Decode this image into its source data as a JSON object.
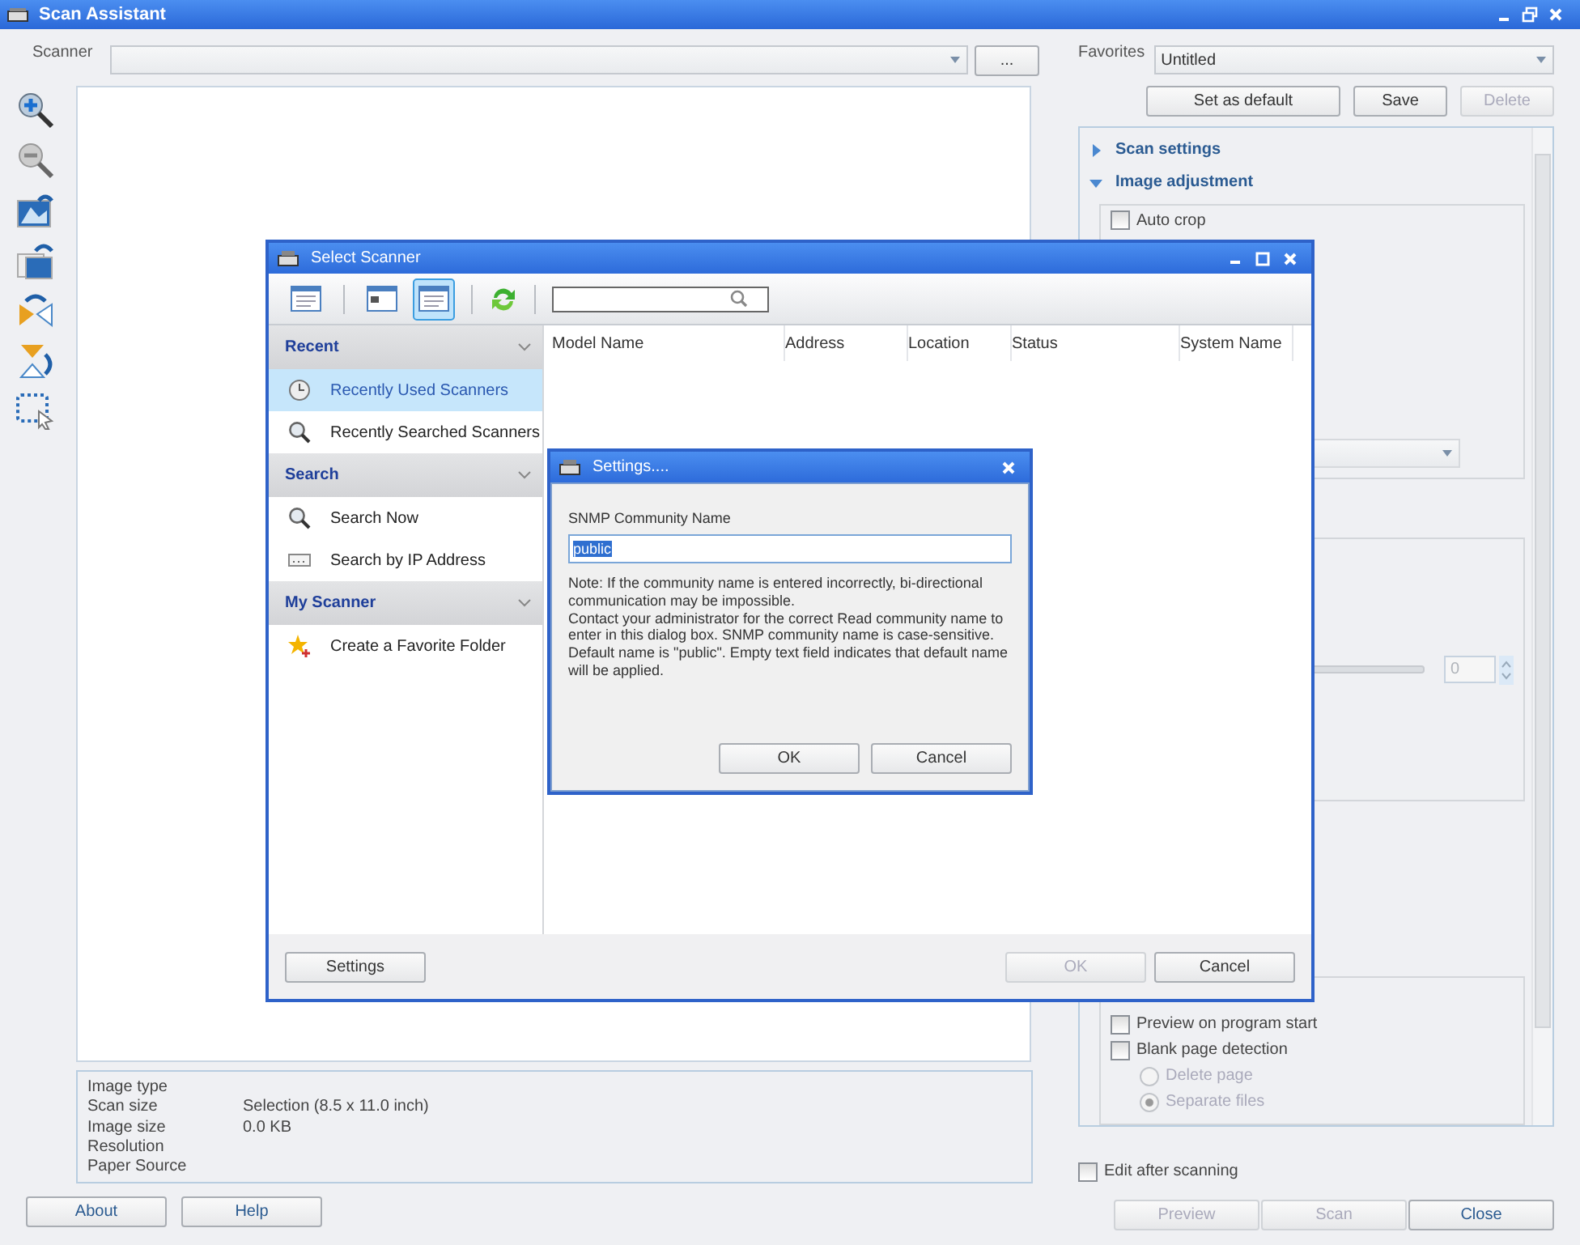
{
  "window": {
    "title": "Scan Assistant"
  },
  "scanner": {
    "label": "Scanner",
    "browse_button": "..."
  },
  "preview_info": [
    {
      "label": "Image type"
    },
    {
      "label": "Scan size",
      "value": "Selection (8.5 x 11.0 inch)"
    },
    {
      "label": "Image size",
      "value": "0.0 KB"
    },
    {
      "label": "Resolution"
    },
    {
      "label": "Paper Source"
    }
  ],
  "footer_left": [
    "About",
    "Help"
  ],
  "favorites": {
    "label": "Favorites",
    "value": "Untitled",
    "buttons": [
      {
        "label": "Set as default",
        "disabled": false
      },
      {
        "label": "Save",
        "disabled": false
      },
      {
        "label": "Delete",
        "disabled": true
      }
    ]
  },
  "sections": [
    {
      "title": "Scan settings",
      "expanded": false
    },
    {
      "title": "Image adjustment",
      "expanded": true
    }
  ],
  "auto_crop": {
    "label": "Auto crop",
    "checked": false
  },
  "spin": {
    "value": "0"
  },
  "options": [
    {
      "kind": "checkbox",
      "label": "Preview on program start",
      "checked": false
    },
    {
      "kind": "checkbox",
      "label": "Blank page detection",
      "checked": false
    },
    {
      "kind": "radio",
      "label": "Delete page",
      "selected": false,
      "disabled": true
    },
    {
      "kind": "radio",
      "label": "Separate files",
      "selected": true,
      "disabled": true
    }
  ],
  "edit_after": {
    "label": "Edit after scanning",
    "checked": false
  },
  "footer_right": [
    {
      "label": "Preview",
      "disabled": true
    },
    {
      "label": "Scan",
      "disabled": true
    },
    {
      "label": "Close",
      "disabled": false
    }
  ],
  "select_scanner": {
    "title": "Select Scanner",
    "views": [
      {
        "selected": false
      },
      {
        "selected": false
      },
      {
        "selected": true
      }
    ],
    "groups": [
      {
        "title": "Recent",
        "items": [
          {
            "label": "Recently Used Scanners",
            "selected": true
          },
          {
            "label": "Recently Searched Scanners",
            "selected": false
          }
        ]
      },
      {
        "title": "Search",
        "items": [
          {
            "label": "Search Now",
            "selected": false
          },
          {
            "label": "Search by IP Address",
            "selected": false
          }
        ]
      },
      {
        "title": "My Scanner",
        "items": [
          {
            "label": "Create a Favorite Folder",
            "selected": false
          }
        ]
      }
    ],
    "columns": [
      "Model Name",
      "Address",
      "Location",
      "Status",
      "System Name"
    ],
    "buttons": [
      {
        "label": "Settings",
        "disabled": false
      },
      {
        "label": "OK",
        "disabled": true
      },
      {
        "label": "Cancel",
        "disabled": false
      }
    ]
  },
  "settings_dialog": {
    "title": "Settings....",
    "field_label": "SNMP Community Name",
    "value": "public",
    "note": [
      "Note: If the community name is entered incorrectly, bi-directional communication may be impossible.",
      "Contact your administrator for the correct Read community name to enter in this dialog box. SNMP community name is case-sensitive. Default name is \"public\". Empty text field indicates that default name will be applied."
    ],
    "buttons": [
      "OK",
      "Cancel"
    ]
  }
}
